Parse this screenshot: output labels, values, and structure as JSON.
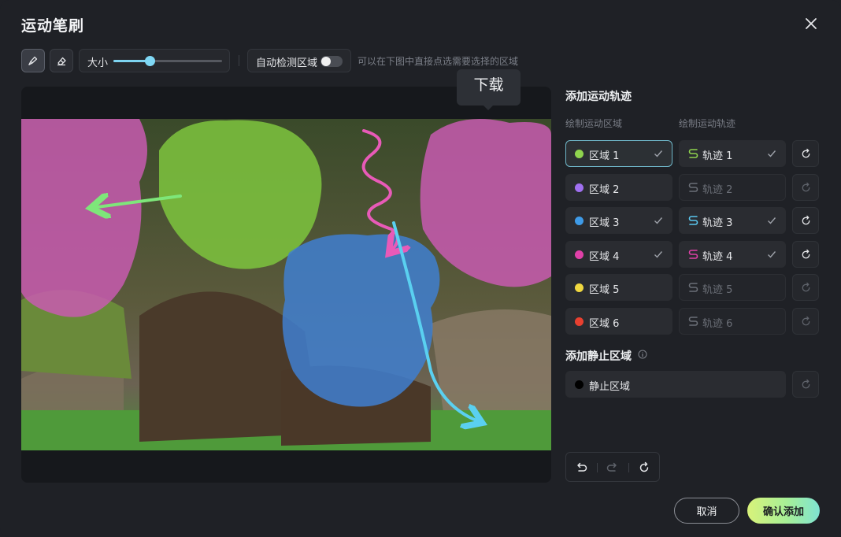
{
  "dialog": {
    "title": "运动笔刷",
    "cancel_label": "取消",
    "confirm_label": "确认添加"
  },
  "toolbar": {
    "size_label": "大小",
    "size_value": 0.33,
    "auto_detect_label": "自动检测区域",
    "auto_detect_on": false,
    "hint": "可以在下图中直接点选需要选择的区域"
  },
  "tooltip": {
    "text": "下载"
  },
  "motion": {
    "title": "添加运动轨迹",
    "region_col": "绘制运动区域",
    "track_col": "绘制运动轨迹",
    "rows": [
      {
        "region": "区域 1",
        "track": "轨迹 1",
        "color": "#8fd44e",
        "track_color": "#8fd44e",
        "region_checked": true,
        "track_checked": true,
        "selected": true,
        "track_enabled": true
      },
      {
        "region": "区域 2",
        "track": "轨迹 2",
        "color": "#a070f0",
        "track_color": "#6b6f77",
        "region_checked": false,
        "track_checked": false,
        "selected": false,
        "track_enabled": false
      },
      {
        "region": "区域 3",
        "track": "轨迹 3",
        "color": "#3e9be8",
        "track_color": "#5ac8f0",
        "region_checked": true,
        "track_checked": true,
        "selected": false,
        "track_enabled": true
      },
      {
        "region": "区域 4",
        "track": "轨迹 4",
        "color": "#e040a8",
        "track_color": "#e040a8",
        "region_checked": true,
        "track_checked": true,
        "selected": false,
        "track_enabled": true
      },
      {
        "region": "区域 5",
        "track": "轨迹 5",
        "color": "#f0d840",
        "track_color": "#6b6f77",
        "region_checked": false,
        "track_checked": false,
        "selected": false,
        "track_enabled": false
      },
      {
        "region": "区域 6",
        "track": "轨迹 6",
        "color": "#e84030",
        "track_color": "#6b6f77",
        "region_checked": false,
        "track_checked": false,
        "selected": false,
        "track_enabled": false
      }
    ]
  },
  "static": {
    "title": "添加静止区域",
    "label": "静止区域",
    "color": "#000000"
  }
}
